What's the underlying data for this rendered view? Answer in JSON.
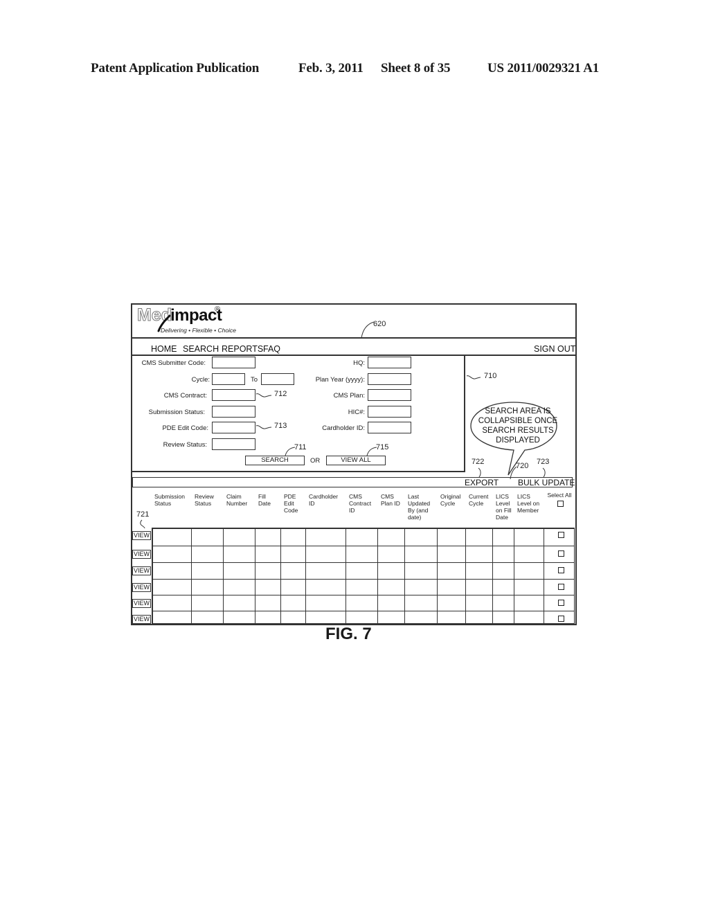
{
  "patent_header": {
    "publication": "Patent Application Publication",
    "date": "Feb. 3, 2011",
    "sheet": "Sheet 8 of 35",
    "number": "US 2011/0029321 A1"
  },
  "logo": {
    "brand_left": "Med",
    "brand_right": "impact",
    "registered": "®",
    "tagline": "Delivering • Flexible • Choice"
  },
  "nav": {
    "items": [
      "HOME",
      "SEARCH",
      "REPORTS",
      "FAQ"
    ],
    "sign_out": "SIGN OUT"
  },
  "search_form": {
    "left_fields": [
      {
        "label": "CMS Submitter Code:",
        "value": ""
      },
      {
        "label": "Cycle:",
        "value": "",
        "to_label": "To",
        "to_value": ""
      },
      {
        "label": "CMS Contract:",
        "value": ""
      },
      {
        "label": "Submission Status:",
        "value": ""
      },
      {
        "label": "PDE Edit Code:",
        "value": ""
      },
      {
        "label": "Review Status:",
        "value": ""
      }
    ],
    "right_fields": [
      {
        "label": "HQ:",
        "value": ""
      },
      {
        "label": "Plan Year (yyyy):",
        "value": ""
      },
      {
        "label": "CMS Plan:",
        "value": ""
      },
      {
        "label": "HIC#:",
        "value": ""
      },
      {
        "label": "Cardholder ID:",
        "value": ""
      }
    ],
    "search_button": "SEARCH",
    "or_label": "OR",
    "view_all_button": "VIEW ALL"
  },
  "callout": {
    "lines": [
      "SEARCH AREA IS",
      "COLLAPSIBLE ONCE",
      "SEARCH RESULTS",
      "DISPLAYED"
    ]
  },
  "results_bar": {
    "export": "EXPORT",
    "bulk_update": "BULK UPDATE"
  },
  "table": {
    "columns": [
      "Submission Status",
      "Review Status",
      "Claim Number",
      "Fill Date",
      "PDE Edit Code",
      "Cardholder ID",
      "CMS Contract ID",
      "CMS Plan ID",
      "Last Updated By (and date)",
      "Original Cycle",
      "Current Cycle",
      "LICS Level on Fill Date",
      "LICS Level on Member",
      "Select All"
    ],
    "row_count": 6,
    "view_label": "VIEW"
  },
  "reference_numerals": {
    "r620": "620",
    "r710": "710",
    "r711": "711",
    "r712": "712",
    "r713": "713",
    "r715": "715",
    "r720": "720",
    "r721": "721",
    "r722": "722",
    "r723": "723"
  },
  "figure_label": "FIG. 7"
}
